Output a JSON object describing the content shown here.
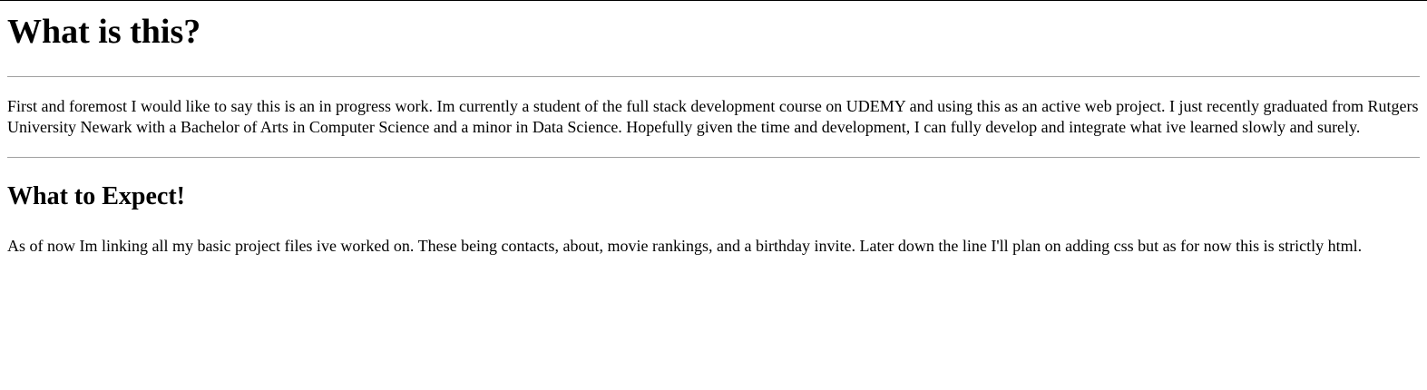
{
  "article": {
    "title": "What is this?",
    "intro": "First and foremost I would like to say this is an in progress work. Im currently a student of the full stack development course on UDEMY and using this as an active web project. I just recently graduated from Rutgers University Newark with a Bachelor of Arts in Computer Science and a minor in Data Science. Hopefully given the time and development, I can fully develop and integrate what ive learned slowly and surely.",
    "section_heading": "What to Expect!",
    "section_body": "As of now Im linking all my basic project files ive worked on. These being contacts, about, movie rankings, and a birthday invite. Later down the line I'll plan on adding css but as for now this is strictly html."
  }
}
